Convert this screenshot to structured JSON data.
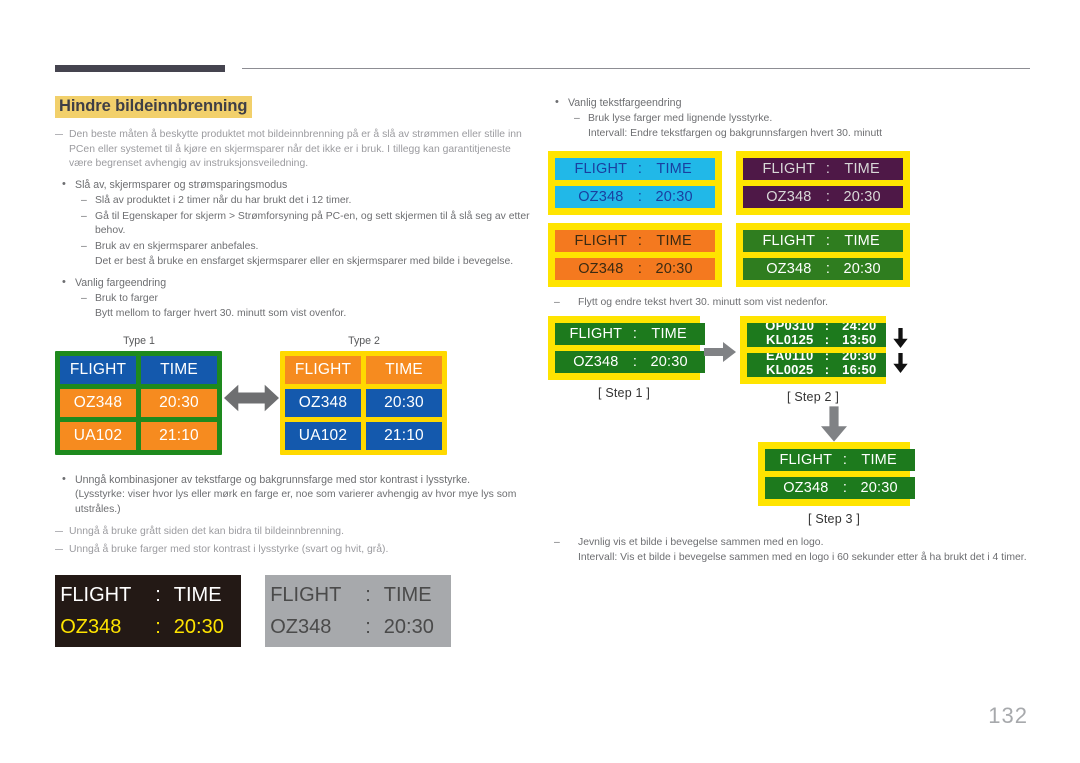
{
  "page": {
    "title": "Hindre bildeinnbrenning",
    "number": "132",
    "title_highlight_color": "#f2d06b"
  },
  "left_column": {
    "intro_note": "Den beste måten å beskytte produktet mot bildeinnbrenning på er å slå av strømmen eller stille inn PCen eller systemet til å kjøre en skjermsparer når det ikke er i bruk. I tillegg kan garantitjeneste være begrenset avhengig av instruksjonsveiledning.",
    "bullet1": "Slå av, skjermsparer og strømsparingsmodus",
    "dash1": "Slå av produktet i 2 timer når du har brukt det i 12 timer.",
    "dash2": "Gå til Egenskaper for skjerm > Strømforsyning på PC-en, og sett skjermen til å slå seg av etter behov.",
    "dash3": "Bruk av en skjermsparer anbefales.",
    "dash3_sub": "Det er best å bruke en ensfarget skjermsparer eller en skjermsparer med bilde i bevegelse.",
    "bullet2": "Vanlig fargeendring",
    "dash4": "Bruk to farger",
    "dash4_sub": "Bytt mellom to farger hvert 30. minutt som vist ovenfor.",
    "bullet3": "Unngå kombinasjoner av tekstfarge og bakgrunnsfarge med stor kontrast i lysstyrke.",
    "bullet3_sub": "(Lysstyrke: viser hvor lys eller mørk en farge er, noe som varierer avhengig av hvor mye lys som utstråles.)",
    "note2": "Unngå å bruke grått siden det kan bidra til bildeinnbrenning.",
    "note3": "Unngå å bruke farger med stor kontrast i lysstyrke (svart og hvit, grå)."
  },
  "type_boards": {
    "type1_label": "Type 1",
    "type2_label": "Type 2",
    "headers": [
      "FLIGHT",
      "TIME"
    ],
    "rows": [
      [
        "OZ348",
        "20:30"
      ],
      [
        "UA102",
        "21:10"
      ]
    ],
    "type1": {
      "frame": "#1e8a1e",
      "header_bg": "#1459ad",
      "header_fg": "#ffffff",
      "row_bg": "#f68b1f",
      "row_fg": "#ffffff"
    },
    "type2": {
      "frame": "#ffd900",
      "header_bg": "#f68b1f",
      "header_fg": "#ffffff",
      "row_bg": "#1459ad",
      "row_fg": "#ffffff"
    },
    "arrow": "double-arrow-horizontal"
  },
  "contrast_boards": {
    "dark": {
      "bg": "#231915",
      "row1": {
        "a": "FLIGHT",
        "sep": ":",
        "b": "TIME",
        "fg": "#ffffff"
      },
      "row2": {
        "a": "OZ348",
        "sep": ":",
        "b": "20:30",
        "fg": "#ffe400"
      }
    },
    "gray": {
      "bg": "#a7a9ac",
      "row1": {
        "a": "FLIGHT",
        "sep": ":",
        "b": "TIME",
        "fg": "#4a4a4a"
      },
      "row2": {
        "a": "OZ348",
        "sep": ":",
        "b": "20:30",
        "fg": "#4a4a4a"
      }
    }
  },
  "right_column": {
    "bullet1": "Vanlig tekstfargeendring",
    "dash1": "Bruk lyse farger med lignende lysstyrke.",
    "dash1_sub": "Intervall: Endre tekstfargen og bakgrunnsfargen hvert 30. minutt",
    "dash2": "Flytt og endre tekst hvert 30. minutt som vist nedenfor.",
    "dash3": "Jevnlig vis et bilde i bevegelse sammen med en logo.",
    "dash3_sub": "Intervall: Vis et bilde i bevegelse sammen med en logo i 60 sekunder etter å ha brukt det i 4 timer."
  },
  "color_boards": {
    "frame": "#ffe400",
    "row1_text": {
      "a": "FLIGHT",
      "sep": ":",
      "b": "TIME"
    },
    "row2_text": {
      "a": "OZ348",
      "sep": ":",
      "b": "20:30"
    },
    "items": [
      {
        "name": "cyan-board",
        "bg": "#21b8e8",
        "fg": "#1a3fa0"
      },
      {
        "name": "purple-board",
        "bg": "#4e1847",
        "fg": "#d8d8d8"
      },
      {
        "name": "orange-board",
        "bg": "#f4791f",
        "fg": "#3a2a12"
      },
      {
        "name": "green-board",
        "bg": "#2f7d1f",
        "fg": "#ffffff"
      }
    ]
  },
  "steps": {
    "step1_label": "[ Step 1 ]",
    "step2_label": "[ Step 2 ]",
    "step3_label": "[ Step 3 ]",
    "board_frame": "#ffe400",
    "board_bg": "#1d7a1d",
    "board_fg": "#ffffff",
    "step1_rows": [
      {
        "a": "FLIGHT",
        "sep": ":",
        "b": "TIME"
      },
      {
        "a": "OZ348",
        "sep": ":",
        "b": "20:30"
      }
    ],
    "step2_rows": [
      {
        "a": "OP0310",
        "sep": ":",
        "b": "24:20"
      },
      {
        "a": "KL0125",
        "sep": ":",
        "b": "13:50"
      },
      {
        "a": "EA0110",
        "sep": ":",
        "b": "20:30"
      },
      {
        "a": "KL0025",
        "sep": ":",
        "b": "16:50"
      }
    ],
    "step3_rows": [
      {
        "a": "FLIGHT",
        "sep": ":",
        "b": "TIME"
      },
      {
        "a": "OZ348",
        "sep": ":",
        "b": "20:30"
      }
    ]
  }
}
